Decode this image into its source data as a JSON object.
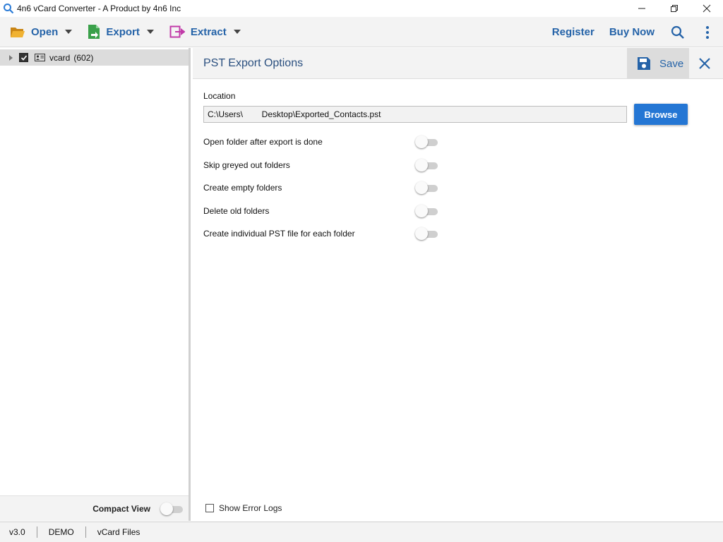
{
  "window": {
    "title": "4n6 vCard Converter - A Product by 4n6 Inc",
    "minimize_glyph": "—",
    "restore_glyph": "❐",
    "close_glyph": "✕"
  },
  "toolbar": {
    "open_label": "Open",
    "export_label": "Export",
    "extract_label": "Extract",
    "register_label": "Register",
    "buy_now_label": "Buy Now"
  },
  "tree": {
    "root_label": "vcard",
    "root_count": "(602)",
    "checked": true
  },
  "compact_view": {
    "label": "Compact View",
    "enabled": false
  },
  "panel": {
    "title": "PST Export Options",
    "save_label": "Save",
    "location_label": "Location",
    "location_value": "C:\\Users\\        Desktop\\Exported_Contacts.pst",
    "browse_label": "Browse",
    "options": [
      {
        "label": "Open folder after export is done",
        "enabled": false
      },
      {
        "label": "Skip greyed out folders",
        "enabled": false
      },
      {
        "label": "Create empty folders",
        "enabled": false
      },
      {
        "label": "Delete old folders",
        "enabled": false
      },
      {
        "label": "Create individual PST file for each folder",
        "enabled": false
      }
    ],
    "show_error_logs_label": "Show Error Logs"
  },
  "statusbar": {
    "version": "v3.0",
    "mode": "DEMO",
    "file_type": "vCard Files"
  },
  "colors": {
    "accent": "#2563a8",
    "button_blue": "#2476d4",
    "open_folder_icon": "#e8a020",
    "export_icon": "#3aa04a",
    "extract_icon": "#c13aa8"
  }
}
